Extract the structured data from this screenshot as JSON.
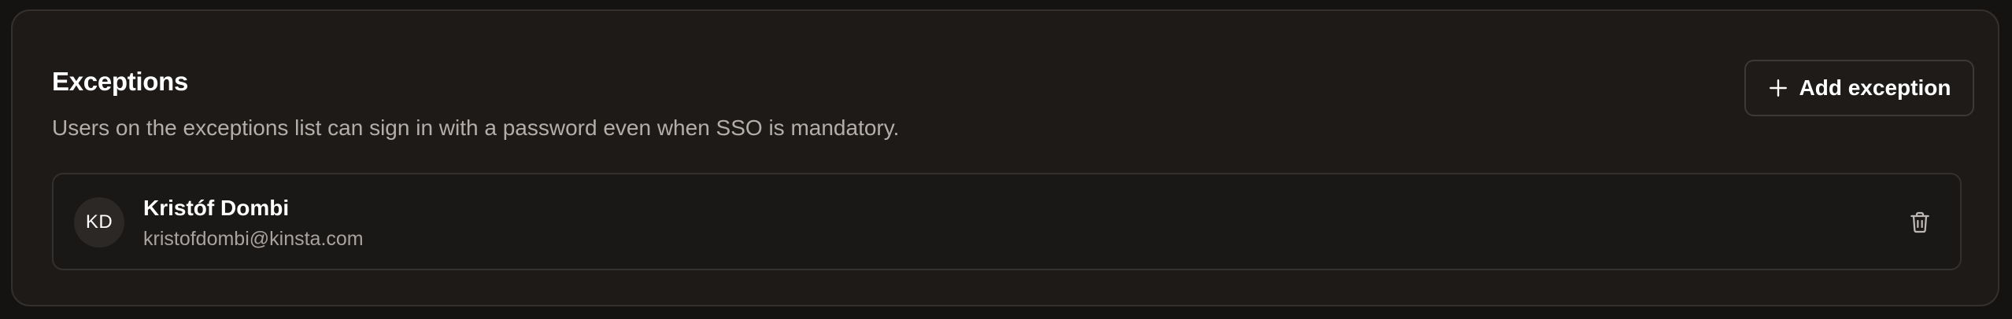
{
  "section": {
    "title": "Exceptions",
    "description": "Users on the exceptions list can sign in with a password even when SSO is mandatory.",
    "add_button_label": "Add exception",
    "add_button_icon": "plus-icon"
  },
  "exceptions": [
    {
      "initials": "KD",
      "name": "Kristóf Dombi",
      "email": "kristofdombi@kinsta.com",
      "action_icon": "trash-icon"
    }
  ],
  "colors": {
    "page_background": "#141312",
    "card_background": "#1d1a18",
    "border": "#34302d",
    "text_primary": "#ffffff",
    "text_secondary": "#b3aeaa"
  }
}
